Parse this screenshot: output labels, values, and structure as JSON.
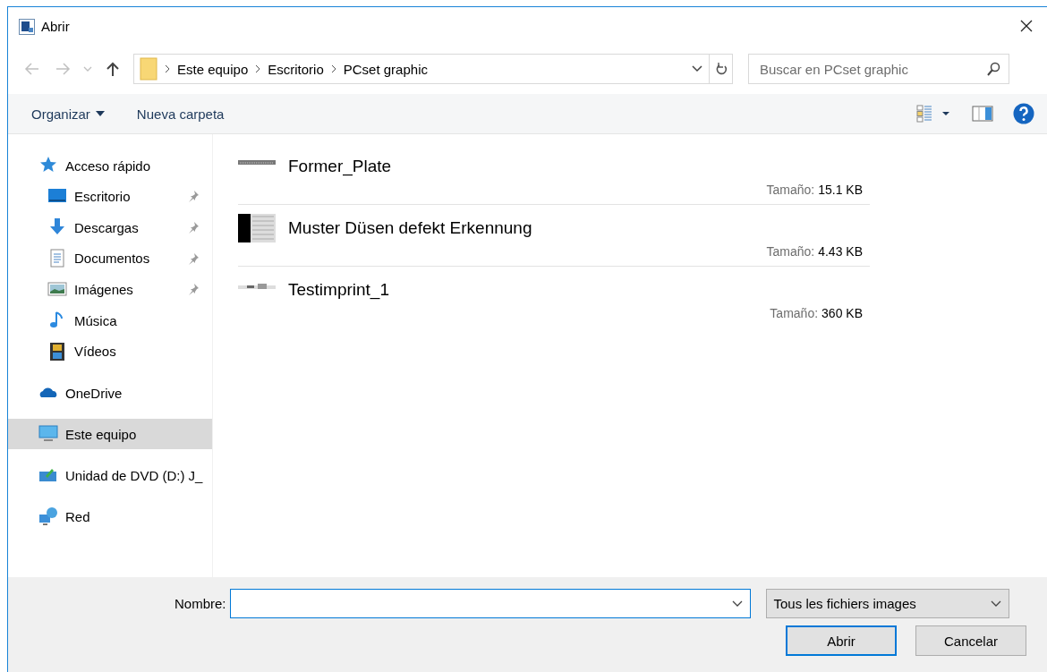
{
  "window": {
    "title": "Abrir"
  },
  "address_bar": {
    "path": [
      "Este equipo",
      "Escritorio",
      "PCset graphic"
    ]
  },
  "search": {
    "placeholder": "Buscar en PCset graphic"
  },
  "toolbar": {
    "buttons": [
      {
        "label": "Organizar",
        "dropdown": true
      },
      {
        "label": "Nueva carpeta",
        "dropdown": false
      }
    ]
  },
  "sidebar": {
    "items": [
      {
        "label": "Acceso rápido",
        "kind": "star",
        "selected": false,
        "children": [
          {
            "label": "Escritorio",
            "kind": "desktop",
            "pinned": true,
            "selected": false
          },
          {
            "label": "Descargas",
            "kind": "download",
            "pinned": true,
            "selected": false
          },
          {
            "label": "Documentos",
            "kind": "document",
            "pinned": true,
            "selected": false
          },
          {
            "label": "Imágenes",
            "kind": "pictures",
            "pinned": true,
            "selected": false
          },
          {
            "label": "Música",
            "kind": "music",
            "pinned": false,
            "selected": false
          },
          {
            "label": "Vídeos",
            "kind": "videos",
            "pinned": false,
            "selected": false
          }
        ]
      },
      {
        "label": "OneDrive",
        "kind": "cloud",
        "selected": false
      },
      {
        "label": "Este equipo",
        "kind": "computer",
        "selected": true
      },
      {
        "label": "Unidad de DVD (D:) J_",
        "kind": "dvd",
        "selected": false
      },
      {
        "label": "Red",
        "kind": "network",
        "selected": false
      }
    ]
  },
  "files": [
    {
      "name": "Former_Plate",
      "size_label": "Tamaño:",
      "size": "15.1 KB",
      "kind": "strip"
    },
    {
      "name": "Muster Düsen defekt Erkennung",
      "size_label": "Tamaño:",
      "size": "4.43 KB",
      "kind": "block"
    },
    {
      "name": "Testimprint_1",
      "size_label": "Tamaño:",
      "size": "360 KB",
      "kind": "mixed"
    }
  ],
  "footer": {
    "name_label": "Nombre:",
    "file_type": "Tous les fichiers images",
    "buttons": [
      {
        "label": "Abrir",
        "default": true
      },
      {
        "label": "Cancelar",
        "default": false
      }
    ]
  }
}
